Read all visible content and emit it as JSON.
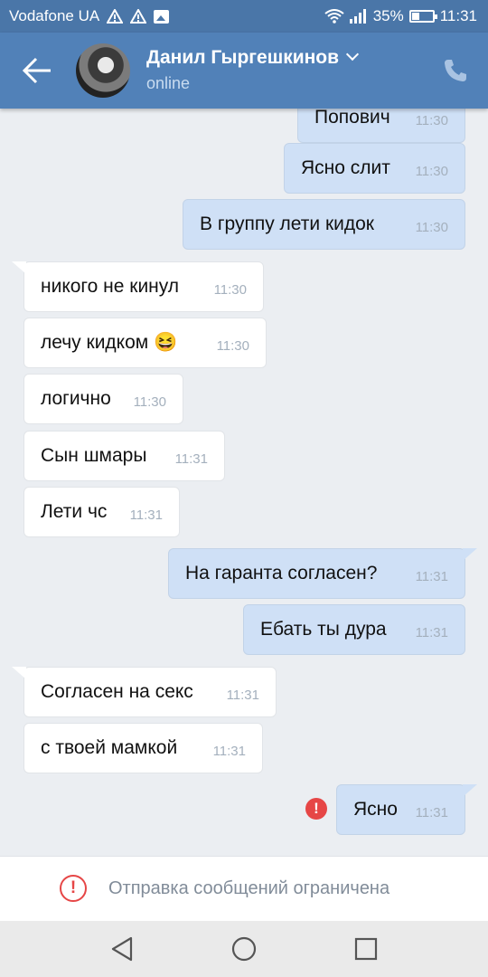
{
  "status_bar": {
    "carrier": "Vodafone UA",
    "battery": "35%",
    "time": "11:31"
  },
  "header": {
    "contact_name": "Данил Гыргешкинов",
    "presence": "online"
  },
  "messages": [
    {
      "dir": "out",
      "text": "Попович",
      "time": "11:30"
    },
    {
      "dir": "out",
      "text": "Ясно слит",
      "time": "11:30"
    },
    {
      "dir": "out",
      "text": "В группу лети кидок",
      "time": "11:30"
    },
    {
      "dir": "in",
      "text": "никого не кинул",
      "time": "11:30"
    },
    {
      "dir": "in",
      "text": "лечу кидком 😆",
      "time": "11:30"
    },
    {
      "dir": "in",
      "text": "логично",
      "time": "11:30"
    },
    {
      "dir": "in",
      "text": "Сын шмары",
      "time": "11:31"
    },
    {
      "dir": "in",
      "text": "Лети чс",
      "time": "11:31"
    },
    {
      "dir": "out",
      "text": "На гаранта согласен?",
      "time": "11:31"
    },
    {
      "dir": "out",
      "text": "Ебать ты дура",
      "time": "11:31"
    },
    {
      "dir": "in",
      "text": "Согласен на секс",
      "time": "11:31"
    },
    {
      "dir": "in",
      "text": "с твоей мамкой",
      "time": "11:31"
    },
    {
      "dir": "out",
      "text": "Ясно",
      "time": "11:31",
      "failed": true
    }
  ],
  "error_icon": "!",
  "restriction": {
    "icon": "!",
    "text": "Отправка сообщений ограничена"
  },
  "colors": {
    "header": "#5181b8",
    "status_bar": "#4a76a8",
    "outgoing_bubble": "#cfe0f6",
    "incoming_bubble": "#ffffff",
    "error": "#e64646"
  },
  "icons": {
    "back": "arrow-left-icon",
    "call": "phone-icon",
    "nav": [
      "back-triangle-icon",
      "home-circle-icon",
      "recents-square-icon"
    ]
  }
}
